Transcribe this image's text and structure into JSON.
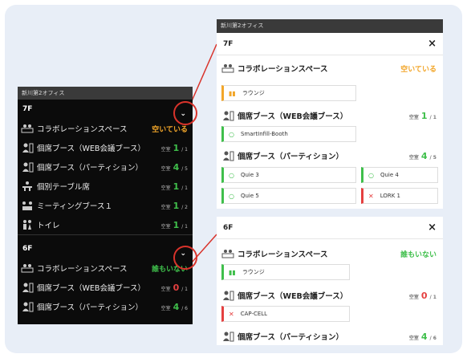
{
  "left": {
    "header": "新川第2オフィス",
    "floor7": {
      "label": "7F",
      "rows": [
        {
          "icon": "collab-space-icon",
          "name": "コラボレーションスペース",
          "status": "空いている"
        },
        {
          "icon": "booth-icon",
          "name": "個席ブース（WEB会議ブース）",
          "caption": "空室",
          "count": "1",
          "total": "/ 1"
        },
        {
          "icon": "booth-icon",
          "name": "個席ブース（パーティション）",
          "caption": "空室",
          "count": "4",
          "total": "/ 5"
        },
        {
          "icon": "table-icon",
          "name": "個別テーブル席",
          "caption": "空室",
          "count": "1",
          "total": "/ 1"
        },
        {
          "icon": "meeting-icon",
          "name": "ミーティングブース１",
          "caption": "空室",
          "count": "1",
          "total": "/ 2"
        },
        {
          "icon": "toilet-icon",
          "name": "トイレ",
          "caption": "空室",
          "count": "1",
          "total": "/ 1"
        }
      ]
    },
    "floor6": {
      "label": "6F",
      "rows": [
        {
          "icon": "collab-space-icon",
          "name": "コラボレーションスペース",
          "status": "誰もいない"
        },
        {
          "icon": "booth-icon",
          "name": "個席ブース（WEB会議ブース）",
          "caption": "空室",
          "count": "0",
          "total": "/ 1"
        },
        {
          "icon": "booth-icon",
          "name": "個席ブース（パーティション）",
          "caption": "空室",
          "count": "4",
          "total": "/ 6"
        }
      ]
    }
  },
  "right7": {
    "header": "新川第2オフィス",
    "floor": "7F",
    "close": "×",
    "collab": {
      "name": "コラボレーションスペース",
      "status": "空いている",
      "chip": "ラウンジ"
    },
    "web": {
      "name": "個席ブース（WEB会議ブース）",
      "caption": "空室",
      "count": "1",
      "total": "/ 1",
      "chip": "SmartInfill-Booth"
    },
    "partition": {
      "name": "個席ブース（パーティション）",
      "caption": "空室",
      "count": "4",
      "total": "/ 5",
      "chips": [
        "Quie 3",
        "Quie 4",
        "Quie 5",
        "LORK 1"
      ]
    }
  },
  "right6": {
    "floor": "6F",
    "close": "×",
    "collab": {
      "name": "コラボレーションスペース",
      "status": "誰もいない",
      "chip": "ラウンジ"
    },
    "web": {
      "name": "個席ブース（WEB会議ブース）",
      "caption": "空室",
      "count": "0",
      "total": "/ 1",
      "chip": "CAP-CELL"
    },
    "partition": {
      "name": "個席ブース（パーティション）",
      "caption": "空室",
      "count": "4",
      "total": "/ 6"
    }
  },
  "colors": {
    "available": "#3fbf4b",
    "occupied": "#e54040",
    "free_text": "#f2a62a",
    "highlight": "#d9332b"
  }
}
